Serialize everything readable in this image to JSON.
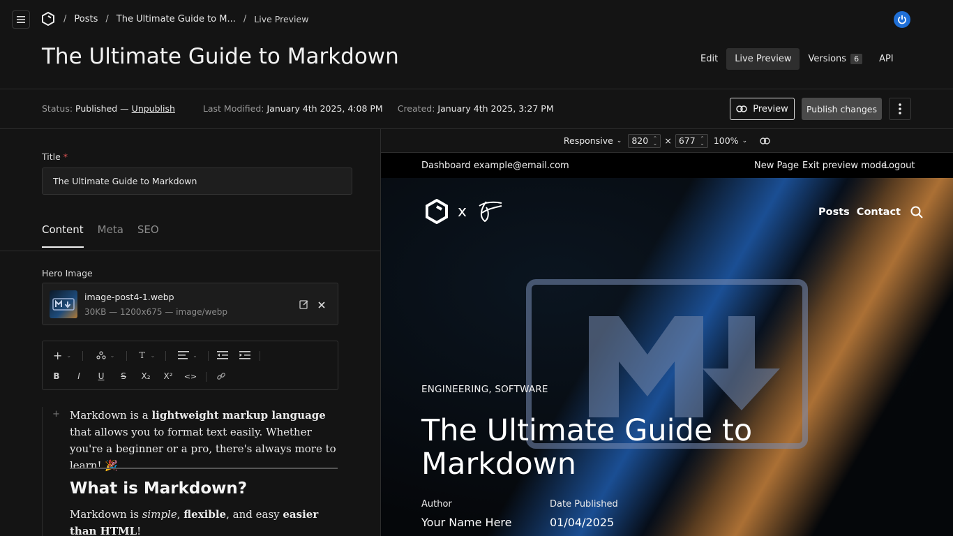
{
  "breadcrumb": {
    "sep": "/",
    "items": [
      "Posts",
      "The Ultimate Guide to M...",
      "Live Preview"
    ]
  },
  "document": {
    "title": "The Ultimate Guide to Markdown"
  },
  "view_tabs": [
    {
      "label": "Edit"
    },
    {
      "label": "Live Preview"
    },
    {
      "label": "Versions",
      "count": "6"
    },
    {
      "label": "API"
    }
  ],
  "status": {
    "status_label": "Status:",
    "status_value": "Published —",
    "unpublish": "Unpublish",
    "modified_label": "Last Modified:",
    "modified_value": "January 4th 2025, 4:08 PM",
    "created_label": "Created:",
    "created_value": "January 4th 2025, 3:27 PM"
  },
  "actions": {
    "preview": "Preview",
    "publish": "Publish changes"
  },
  "form": {
    "title_label": "Title",
    "required_mark": "*",
    "title_value": "The Ultimate Guide to Markdown",
    "tabs": [
      "Content",
      "Meta",
      "SEO"
    ],
    "hero_label": "Hero Image",
    "hero_file": "image-post4-1.webp",
    "hero_meta": "30KB — 1200x675 — image/webp"
  },
  "toolbar": {
    "block_type": "T",
    "bold": "B",
    "italic": "I",
    "underline": "U",
    "strike": "S",
    "subscript": "X₂",
    "superscript": "X²",
    "code": "<>"
  },
  "editor": {
    "p1_a": "Markdown is a ",
    "p1_b": "lightweight markup language",
    "p1_c": " that allows you to format text easily. Whether you're a beginner or a pro, there's always more to learn! 🎉",
    "h2": "What is Markdown?",
    "p2_a": "Markdown is ",
    "p2_b": "simple",
    "p2_c": ", ",
    "p2_d": "flexible",
    "p2_e": ", and easy ",
    "p2_f": "easier than HTML",
    "p2_g": "!"
  },
  "preview_tools": {
    "mode": "Responsive",
    "width": "820",
    "times": "×",
    "height": "677",
    "zoom": "100%"
  },
  "preview": {
    "admin_left": [
      "Dashboard",
      "example@email.com"
    ],
    "admin_right": [
      "New Page",
      "Exit preview mode",
      "Logout"
    ],
    "logo_x": "x",
    "nav": [
      "Posts",
      "Contact"
    ],
    "categories": "ENGINEERING, SOFTWARE",
    "title": "The Ultimate Guide to Markdown",
    "author_label": "Author",
    "author_value": "Your Name Here",
    "date_label": "Date Published",
    "date_value": "01/04/2025"
  }
}
